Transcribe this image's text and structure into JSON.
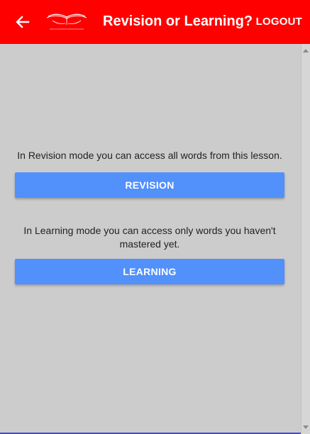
{
  "appbar": {
    "title": "Revision or Learning?",
    "logout_label": "LOGOUT",
    "back_icon": "arrow-left-icon",
    "logo_icon": "open-book-logo"
  },
  "main": {
    "revision_description": "In Revision mode you can access all words from this lesson.",
    "revision_button_label": "REVISION",
    "learning_description": "In Learning mode you can access only words you haven't mastered yet.",
    "learning_button_label": "LEARNING"
  },
  "colors": {
    "appbar": "#fe0000",
    "background": "#cccccc",
    "button": "#5290fb",
    "button_text": "#ffffff"
  }
}
